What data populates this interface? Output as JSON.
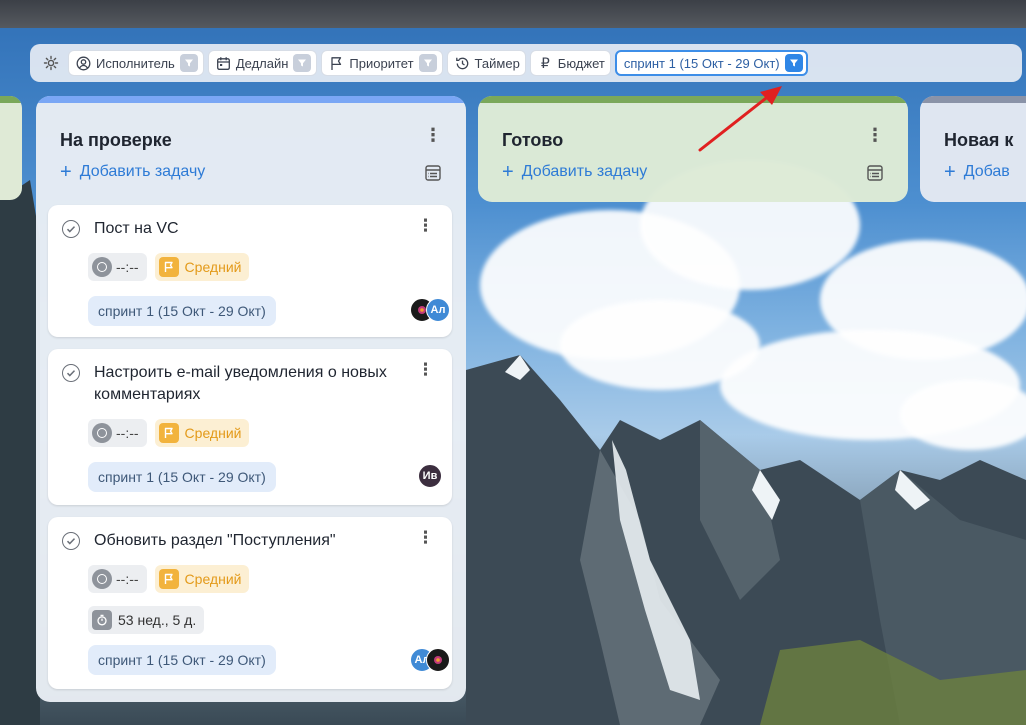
{
  "toolbar": {
    "filters": [
      {
        "label": "Исполнитель",
        "icon": "user-circle-icon",
        "has_filter": true
      },
      {
        "label": "Дедлайн",
        "icon": "calendar-icon",
        "has_filter": true
      },
      {
        "label": "Приоритет",
        "icon": "flag-icon",
        "has_filter": true
      },
      {
        "label": "Таймер",
        "icon": "history-icon",
        "has_filter": false
      },
      {
        "label": "Бюджет",
        "icon": "ruble-icon",
        "has_filter": false
      }
    ],
    "sprint_filter": {
      "label": "спринт 1 (15 Окт - 29 Окт)",
      "active": true
    }
  },
  "columns": {
    "review": {
      "title": "На проверке",
      "add_task": "Добавить задачу",
      "stripe_color": "#7aa7f5",
      "cards": [
        {
          "title": "Пост на VC",
          "timer": "--:--",
          "priority": "Средний",
          "sprint": "спринт 1 (15 Окт - 29 Окт)",
          "avatars": [
            "",
            "Ал"
          ]
        },
        {
          "title": "Настроить e-mail уведомления о новых комментариях",
          "timer": "--:--",
          "priority": "Средний",
          "sprint": "спринт 1 (15 Окт - 29 Окт)",
          "avatars": [
            "Ив"
          ]
        },
        {
          "title": "Обновить раздел \"Поступления\"",
          "timer": "--:--",
          "priority": "Средний",
          "elapsed": "53 нед., 5 д.",
          "sprint": "спринт 1 (15 Окт - 29 Окт)",
          "avatars": [
            "Ал",
            ""
          ]
        }
      ]
    },
    "done": {
      "title": "Готово",
      "add_task": "Добавить задачу",
      "stripe_color": "#7aa85a"
    },
    "new": {
      "title": "Новая к",
      "add_task": "Добав",
      "stripe_color": "#8a93a8"
    }
  },
  "colors": {
    "accent": "#2e7bd6",
    "priority_medium": "#f2b33d",
    "annotation_arrow": "#e02020"
  }
}
